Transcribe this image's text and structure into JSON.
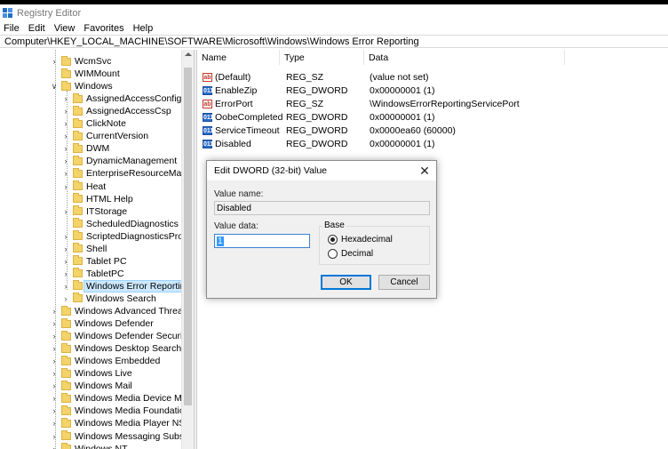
{
  "window": {
    "title": "Registry Editor",
    "address": "Computer\\HKEY_LOCAL_MACHINE\\SOFTWARE\\Microsoft\\Windows\\Windows Error Reporting"
  },
  "menu": [
    "File",
    "Edit",
    "View",
    "Favorites",
    "Help"
  ],
  "tree": [
    {
      "label": "WcmSvc",
      "level": 1,
      "expander": ">"
    },
    {
      "label": "WIMMount",
      "level": 1,
      "expander": ""
    },
    {
      "label": "Windows",
      "level": 1,
      "expander": "v"
    },
    {
      "label": "AssignedAccessConfigura",
      "level": 2,
      "expander": ">"
    },
    {
      "label": "AssignedAccessCsp",
      "level": 2,
      "expander": ">"
    },
    {
      "label": "ClickNote",
      "level": 2,
      "expander": ">"
    },
    {
      "label": "CurrentVersion",
      "level": 2,
      "expander": ">"
    },
    {
      "label": "DWM",
      "level": 2,
      "expander": ">"
    },
    {
      "label": "DynamicManagement",
      "level": 2,
      "expander": ">"
    },
    {
      "label": "EnterpriseResourceManag",
      "level": 2,
      "expander": ">"
    },
    {
      "label": "Heat",
      "level": 2,
      "expander": ">"
    },
    {
      "label": "HTML Help",
      "level": 2,
      "expander": ""
    },
    {
      "label": "ITStorage",
      "level": 2,
      "expander": ">"
    },
    {
      "label": "ScheduledDiagnostics",
      "level": 2,
      "expander": ""
    },
    {
      "label": "ScriptedDiagnosticsProvid",
      "level": 2,
      "expander": ">"
    },
    {
      "label": "Shell",
      "level": 2,
      "expander": ">"
    },
    {
      "label": "Tablet PC",
      "level": 2,
      "expander": ">"
    },
    {
      "label": "TabletPC",
      "level": 2,
      "expander": ">"
    },
    {
      "label": "Windows Error Reporting",
      "level": 2,
      "expander": ">",
      "selected": true
    },
    {
      "label": "Windows Search",
      "level": 2,
      "expander": ">"
    },
    {
      "label": "Windows Advanced Threat Pr",
      "level": 1,
      "expander": ">"
    },
    {
      "label": "Windows Defender",
      "level": 1,
      "expander": ">"
    },
    {
      "label": "Windows Defender Security C",
      "level": 1,
      "expander": ">"
    },
    {
      "label": "Windows Desktop Search",
      "level": 1,
      "expander": ">"
    },
    {
      "label": "Windows Embedded",
      "level": 1,
      "expander": ">"
    },
    {
      "label": "Windows Live",
      "level": 1,
      "expander": ">"
    },
    {
      "label": "Windows Mail",
      "level": 1,
      "expander": ">"
    },
    {
      "label": "Windows Media Device Mana",
      "level": 1,
      "expander": ">"
    },
    {
      "label": "Windows Media Foundation",
      "level": 1,
      "expander": ">"
    },
    {
      "label": "Windows Media Player NSS",
      "level": 1,
      "expander": ">"
    },
    {
      "label": "Windows Messaging Subsyste",
      "level": 1,
      "expander": ">"
    },
    {
      "label": "Windows NT",
      "level": 1,
      "expander": ">"
    }
  ],
  "values": {
    "columns": [
      "Name",
      "Type",
      "Data"
    ],
    "rows": [
      {
        "name": "(Default)",
        "type": "REG_SZ",
        "data": "(value not set)",
        "icon": "ab"
      },
      {
        "name": "EnableZip",
        "type": "REG_DWORD",
        "data": "0x00000001 (1)",
        "icon": "dw"
      },
      {
        "name": "ErrorPort",
        "type": "REG_SZ",
        "data": "\\WindowsErrorReportingServicePort",
        "icon": "ab"
      },
      {
        "name": "OobeCompleted",
        "type": "REG_DWORD",
        "data": "0x00000001 (1)",
        "icon": "dw"
      },
      {
        "name": "ServiceTimeout",
        "type": "REG_DWORD",
        "data": "0x0000ea60 (60000)",
        "icon": "dw"
      },
      {
        "name": "Disabled",
        "type": "REG_DWORD",
        "data": "0x00000001 (1)",
        "icon": "dw"
      }
    ]
  },
  "dialog": {
    "title": "Edit DWORD (32-bit) Value",
    "close": "✕",
    "value_name_label": "Value name:",
    "value_name": "Disabled",
    "value_data_label": "Value data:",
    "value_data": "1",
    "base_label": "Base",
    "hex_label": "Hexadecimal",
    "dec_label": "Decimal",
    "ok": "OK",
    "cancel": "Cancel"
  },
  "icons": {
    "string_value": "ab",
    "binary_value": "011"
  },
  "colors": {
    "selection": "#cce8ff",
    "accent": "#0078d7"
  }
}
